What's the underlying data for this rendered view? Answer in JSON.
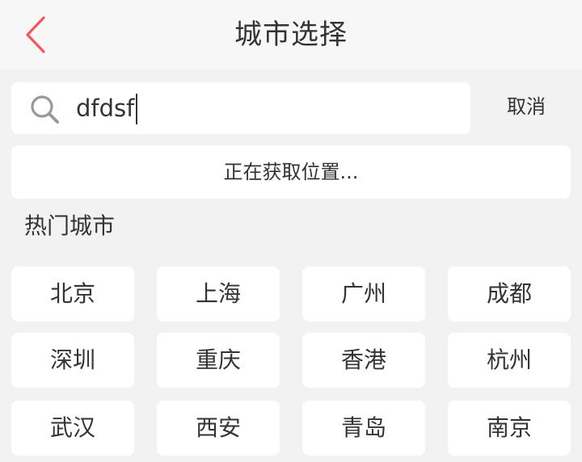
{
  "header": {
    "back_icon": "chevron-left-icon",
    "title": "城市选择",
    "accent_color": "#f0575b"
  },
  "search": {
    "icon": "search-icon",
    "value": "dfdsf",
    "cancel_label": "取消"
  },
  "location": {
    "status": "正在获取位置..."
  },
  "hot_cities": {
    "title": "热门城市",
    "cities": [
      "北京",
      "上海",
      "广州",
      "成都",
      "深圳",
      "重庆",
      "香港",
      "杭州",
      "武汉",
      "西安",
      "青岛",
      "南京"
    ]
  }
}
